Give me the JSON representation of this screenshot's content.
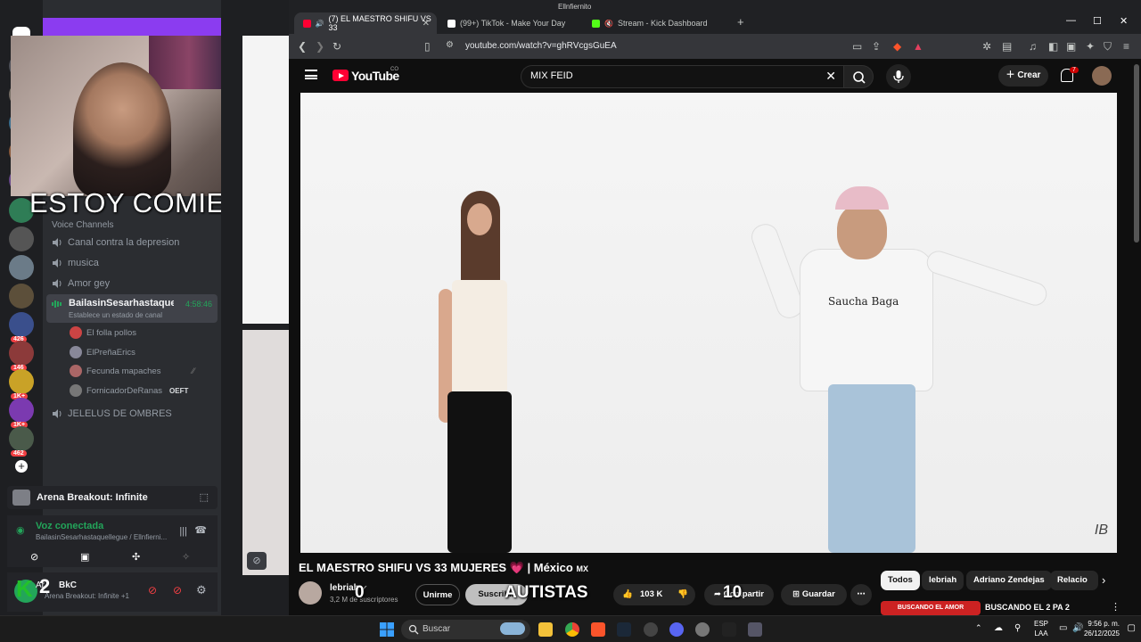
{
  "discord": {
    "overlay_text": "ESTOY COMIENDO",
    "voice_channels_header": "Voice Channels",
    "channels": [
      "Canal contra la depresion",
      "musica",
      "Amor gey"
    ],
    "active_channel": {
      "name": "BailasinSesarhastaque...",
      "status": "Establece un estado de canal",
      "timer": "4:58:46"
    },
    "members": [
      {
        "name": "El folla pollos"
      },
      {
        "name": "ElPreñaErics"
      },
      {
        "name": "Fecunda mapaches"
      },
      {
        "name": "FornicadorDeRanas",
        "tag": "OEFT"
      }
    ],
    "other_channel": "JELELUS DE OMBRES",
    "server_badges": [
      "426",
      "146",
      "1K+",
      "1K+",
      "462"
    ],
    "game": "Arena Breakout: Infinite",
    "voice_status": "Voz conectada",
    "voice_channel_path": "BailasinSesarhastaquellegue / Ellnfierni...",
    "user_name": "BkC",
    "user_status": "Arena Breakout: Infinite +1",
    "user_prefix": "Ar",
    "kick_overlay_k": "K",
    "kick_overlay_n": "2"
  },
  "browser": {
    "window_title": "Ellnfiernito",
    "tabs": [
      {
        "label": "(7) EL MAESTRO SHIFU VS 33",
        "active": true,
        "color": "#ff0033"
      },
      {
        "label": "(99+) TikTok - Make Your Day",
        "active": false,
        "color": "#ffffff"
      },
      {
        "label": "Stream - Kick Dashboard",
        "active": false,
        "color": "#53fc18"
      }
    ],
    "url": "youtube.com/watch?v=ghRVcgsGuEA"
  },
  "youtube": {
    "logo_text": "YouTube",
    "region": "CO",
    "search_query": "MIX FEID",
    "create_label": "Crear",
    "notification_count": "7",
    "video_title": "EL MAESTRO SHIFU VS 33 MUJERES 💗 | México",
    "title_flag": "MX",
    "shirt_print": "Saucha Baga",
    "watermark": "IB",
    "channel_name": "lebriah",
    "subscribers": "3,2 M de suscriptores",
    "join_label": "Unirme",
    "subscribe_label": "Suscribir",
    "likes": "103 K",
    "share_label": "Compartir",
    "save_label": "Guardar",
    "overlay_zero": "0",
    "overlay_autistas": "AUTISTAS",
    "overlay_ten": "10",
    "chips": [
      "Todos",
      "lebriah",
      "Adriano Zendejas",
      "Relacio"
    ],
    "rec_thumb_text": "BUSCANDO EL AMOR",
    "rec_title": "BUSCANDO EL 2 PA 2"
  },
  "taskbar": {
    "search_label": "Buscar",
    "lang_top": "ESP",
    "lang_bottom": "LAA",
    "time": "9:56 p. m.",
    "date": "26/12/2025"
  }
}
